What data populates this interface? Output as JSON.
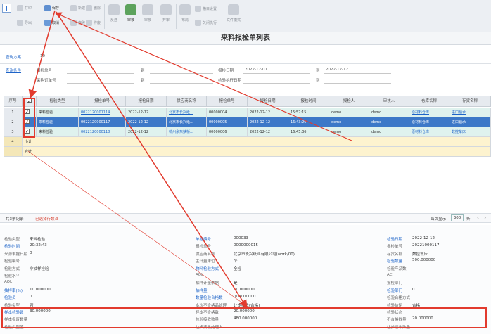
{
  "toolbar": {
    "small_left": [
      {
        "label": "打印",
        "icon": "printer-icon"
      },
      {
        "label": "导出",
        "icon": "export-icon"
      }
    ],
    "save": "保存",
    "cancel": "取消",
    "center": [
      {
        "label": "新建",
        "icon": "new-doc-icon"
      },
      {
        "label": "修改",
        "icon": "edit-icon"
      },
      {
        "label": "删除",
        "icon": "delete-icon"
      },
      {
        "label": "作废",
        "icon": "void-icon"
      }
    ],
    "big": [
      {
        "label": "反选",
        "icon": "reverse-icon"
      },
      {
        "label": "审核",
        "icon": "audit-icon"
      },
      {
        "label": "审核",
        "icon": "check-icon"
      },
      {
        "label": "弃审",
        "icon": "unaudit-icon"
      },
      {
        "label": "布局",
        "icon": "layout-icon"
      },
      {
        "label": "关闭执行",
        "icon": "close-exec-icon"
      },
      {
        "label": "文件模式",
        "icon": "file-mode-icon"
      }
    ],
    "layout_setting": "格目设置"
  },
  "page_title": "来料报检单列表",
  "query": {
    "scheme_label": "查询方案",
    "scheme_value": "10",
    "cond_label": "查询条件",
    "f1_label": "报检单号",
    "to1": "到",
    "f2_label": "报检日期",
    "f2_from": "2022-12-01",
    "to2": "到",
    "f2_to": "2022-12-12",
    "f3_label": "采购订单号",
    "to3": "到",
    "f4_label": "检验执行日期",
    "to4": "到"
  },
  "grid": {
    "headers": [
      "序号",
      "",
      "检验类型",
      "报检单号",
      "报检日期",
      "供应商名称",
      "报检单号",
      "报检日期",
      "报检时间",
      "报检人",
      "审核人",
      "仓库名称",
      "存货名称"
    ],
    "rows": [
      {
        "no": "1",
        "type": "来料检验",
        "code": "0022120001114",
        "date": "2022-12-12",
        "vendor": "北京市长兴纸...",
        "num": "00000004",
        "d2": "2022-12-12",
        "time": "15:57:15",
        "p1": "demo",
        "p2": "demo",
        "wh": "原材料仓库",
        "inv": "进口轴承"
      },
      {
        "no": "2",
        "type": "来料检验",
        "code": "0022120000117",
        "date": "2022-12-12",
        "vendor": "北京市长兴纸...",
        "num": "00000005",
        "d2": "2022-12-12",
        "time": "16:43:20",
        "p1": "demo",
        "p2": "demo",
        "wh": "原材料仓库",
        "inv": "进口轴承"
      },
      {
        "no": "3",
        "type": "来料检验",
        "code": "0022120000118",
        "date": "2022-12-12",
        "vendor": "杭州余东扶桥...",
        "num": "00000006",
        "d2": "2022-12-12",
        "time": "16:45:36",
        "p1": "demo",
        "p2": "demo",
        "wh": "原材料仓库",
        "inv": "数控车床"
      }
    ],
    "row4_no": "4",
    "row4_label": "小计",
    "total_label": "合计"
  },
  "pager": {
    "left": "共3条记录",
    "selected": "已选择行数:3",
    "per_page_label": "每页显示",
    "per_page": "300",
    "unit": "条"
  },
  "detail": {
    "c1": [
      [
        "检验类型",
        "来料检验"
      ],
      [
        "检验时间",
        "20:32:43"
      ],
      [
        "来源单据日期",
        "0"
      ],
      [
        "检验编号",
        ""
      ],
      [
        "检验方式",
        "非抽样检验"
      ],
      [
        "检验水平",
        ""
      ],
      [
        "AQL",
        ""
      ],
      [
        "抽样率(%)",
        "10.000000"
      ],
      [
        "检验员",
        "0"
      ],
      [
        "检验类型",
        "否"
      ],
      [
        "样本检验数",
        "30.000000"
      ],
      [
        "样本报废数量",
        ""
      ],
      [
        "检验类型值",
        ""
      ]
    ],
    "c2": [
      [
        "单据编号",
        "000033"
      ],
      [
        "报检单号",
        "0000000015"
      ],
      [
        "供应商名称",
        "北京市长兴纸业有限公司(work/00)"
      ],
      [
        "主计量单位",
        "个"
      ],
      [
        "物料检验方式",
        "全检"
      ],
      [
        "AQL",
        ""
      ],
      [
        "抽样计量依据",
        "是"
      ],
      [
        "抽样量",
        "50.000000"
      ],
      [
        "数量检验合格数",
        "0000000001"
      ],
      [
        "本次不合格品处理",
        "让步接收(合格)"
      ],
      [
        "样本不合格数",
        "20.000000"
      ],
      [
        "检验接收数量",
        "480.000000"
      ],
      [
        "让步接收处理人",
        ""
      ]
    ],
    "c3": [
      [
        "检验日期",
        "2022-12-12"
      ],
      [
        "报检单号",
        "20221000117"
      ],
      [
        "存货名称",
        "数控车床"
      ],
      [
        "检验数量",
        "500.000000"
      ],
      [
        "检验产品数",
        ""
      ],
      [
        "AC",
        ""
      ],
      [
        "报检部门",
        ""
      ],
      [
        "检验部门",
        "0"
      ],
      [
        "检验合格方式",
        ""
      ],
      [
        "检验结论",
        "合格"
      ],
      [
        "检验状态",
        ""
      ],
      [
        "不合格数量",
        "20.000000"
      ],
      [
        "让步接收数量",
        ""
      ]
    ]
  },
  "colors": {
    "accent": "#1e64c8",
    "selected_row": "#3c78c8",
    "highlight": "#e23b2e"
  }
}
